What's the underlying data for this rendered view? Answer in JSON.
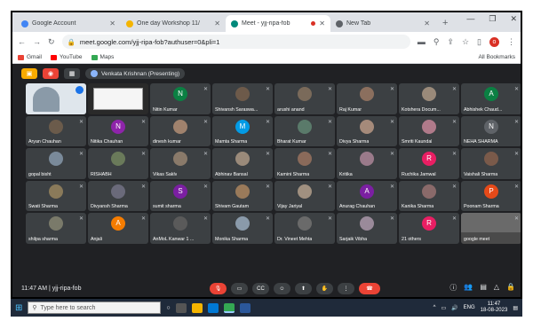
{
  "browser": {
    "tabs": [
      {
        "title": "Google Account",
        "fav_color": "#4285f4",
        "active": false
      },
      {
        "title": "One day Workshop 11/",
        "fav_color": "#f4b400",
        "active": false
      },
      {
        "title": "Meet - yjj-ripa-fob",
        "fav_color": "#00897b",
        "active": true
      },
      {
        "title": "New Tab",
        "fav_color": "#5f6368",
        "active": false
      }
    ],
    "new_tab": "+",
    "address": "meet.google.com/yjj-ripa-fob?authuser=0&pli=1",
    "avatar_letter": "o",
    "bookmarks": [
      {
        "label": "Gmail",
        "color": "#ea4335"
      },
      {
        "label": "YouTube",
        "color": "#ff0000"
      },
      {
        "label": "Maps",
        "color": "#34a853"
      }
    ],
    "all_bookmarks": "All Bookmarks"
  },
  "meet": {
    "presenting": "Venkata Krishnan (Presenting)",
    "participants": [
      {
        "name": "",
        "kind": "video",
        "color": "#8a9aa8"
      },
      {
        "name": "",
        "kind": "screen",
        "color": "#f5f5f5"
      },
      {
        "name": "Nitin Kumar",
        "kind": "letter",
        "letter": "N",
        "color": "#0b8043"
      },
      {
        "name": "Shivansh Saraswa...",
        "kind": "photo",
        "color": "#6d5a4a"
      },
      {
        "name": "arushi anand",
        "kind": "photo",
        "color": "#7a6a5a"
      },
      {
        "name": "Raj Kumar",
        "kind": "photo",
        "color": "#8b6f5e"
      },
      {
        "name": "Kotshera Docum...",
        "kind": "photo",
        "color": "#9a8a7a"
      },
      {
        "name": "Abhishek Chaud...",
        "kind": "letter",
        "letter": "A",
        "color": "#0b8043"
      },
      {
        "name": "Aryan Chauhan",
        "kind": "photo",
        "color": "#6b5b4b"
      },
      {
        "name": "Nitika Chauhan",
        "kind": "letter",
        "letter": "N",
        "color": "#8e24aa"
      },
      {
        "name": "dinesh kumar",
        "kind": "photo",
        "color": "#a0826d"
      },
      {
        "name": "Mamta Sharma",
        "kind": "letter",
        "letter": "M",
        "color": "#039be5"
      },
      {
        "name": "Bharat Kumar",
        "kind": "photo",
        "color": "#5a7a6a"
      },
      {
        "name": "Divya Sharma",
        "kind": "photo",
        "color": "#a58a7a"
      },
      {
        "name": "Smriti Kaundal",
        "kind": "photo",
        "color": "#b07a8a"
      },
      {
        "name": "NEHA SHARMA",
        "kind": "letter",
        "letter": "N",
        "color": "#5f6368"
      },
      {
        "name": "gopal bisht",
        "kind": "photo",
        "color": "#7a8a9a"
      },
      {
        "name": "RISHABH",
        "kind": "photo",
        "color": "#6a7a5a"
      },
      {
        "name": "Vikas Saklv",
        "kind": "photo",
        "color": "#8a7a6a"
      },
      {
        "name": "Abhinav Bansal",
        "kind": "photo",
        "color": "#9a8a7a"
      },
      {
        "name": "Kamini Sharma",
        "kind": "photo",
        "color": "#8a6a5a"
      },
      {
        "name": "Kritika",
        "kind": "photo",
        "color": "#9a7a8a"
      },
      {
        "name": "Ruchika Jamwal",
        "kind": "letter",
        "letter": "R",
        "color": "#e91e63"
      },
      {
        "name": "Vaishali Sharma",
        "kind": "photo",
        "color": "#7a5a4a"
      },
      {
        "name": "Swati Sharma",
        "kind": "photo",
        "color": "#8a7a5a"
      },
      {
        "name": "Divyansh Sharma",
        "kind": "photo",
        "color": "#6a6a7a"
      },
      {
        "name": "sumit sharma",
        "kind": "letter",
        "letter": "S",
        "color": "#7b1fa2"
      },
      {
        "name": "Shivam Gautam",
        "kind": "photo",
        "color": "#9a7a5a"
      },
      {
        "name": "Vijay Jariyal",
        "kind": "photo",
        "color": "#a09080"
      },
      {
        "name": "Anurag Chauhan",
        "kind": "letter",
        "letter": "A",
        "color": "#7b1fa2"
      },
      {
        "name": "Kanika Sharma",
        "kind": "photo",
        "color": "#8a6a6a"
      },
      {
        "name": "Poonam Sharma",
        "kind": "letter",
        "letter": "P",
        "color": "#e64a19"
      },
      {
        "name": "shilpa sharma",
        "kind": "photo",
        "color": "#7a7a6a"
      },
      {
        "name": "Anjali",
        "kind": "letter",
        "letter": "A",
        "color": "#f57c00"
      },
      {
        "name": "AnMoL Kanwar 1 ...",
        "kind": "photo",
        "color": "#5a5a5a"
      },
      {
        "name": "Monika Sharma",
        "kind": "photo",
        "color": "#8a9aaa"
      },
      {
        "name": "Dr. Vineet Mehta",
        "kind": "photo",
        "color": "#6a6a6a"
      },
      {
        "name": "Sarjaik Vibha",
        "kind": "photo",
        "color": "#9a8a9a"
      },
      {
        "name": "21 others",
        "kind": "others",
        "letter": "R",
        "color": "#e91e63"
      },
      {
        "name": "google meet",
        "kind": "screen2",
        "color": "#4a4a4a"
      }
    ],
    "meeting_time": "11:47 AM",
    "meeting_code": "yjj-ripa-fob"
  },
  "taskbar": {
    "search_placeholder": "Type here to search",
    "lang": "ENG",
    "time": "11:47",
    "date": "18-08-2023"
  }
}
